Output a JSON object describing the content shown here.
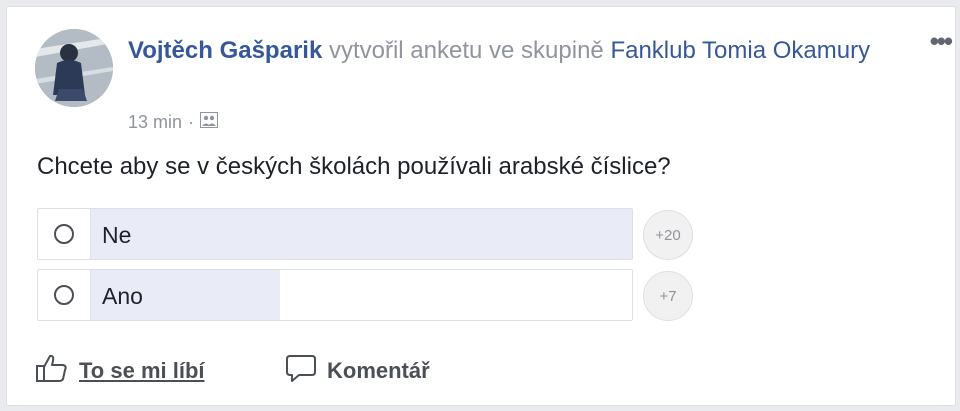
{
  "post": {
    "author": "Vojtěch Gašparik",
    "action_text": " vytvořil anketu ve skupině ",
    "group": "Fanklub Tomia Okamury",
    "time": "13 min",
    "separator": "·",
    "privacy_icon": "group-icon",
    "menu_label": "•••"
  },
  "poll": {
    "question": "Chcete aby se v českých školách používali arabské číslice?",
    "options": [
      {
        "label": "Ne",
        "votes_label": "+20",
        "share": 1.0
      },
      {
        "label": "Ano",
        "votes_label": "+7",
        "share": 0.35
      }
    ]
  },
  "actions": {
    "like_label": "To se mi líbí",
    "comment_label": "Komentář",
    "like_icon": "thumbs-up-icon",
    "comment_icon": "comment-bubble-icon"
  },
  "colors": {
    "link": "#365899",
    "muted": "#90949c",
    "poll_fill": "#e9ebf6"
  }
}
